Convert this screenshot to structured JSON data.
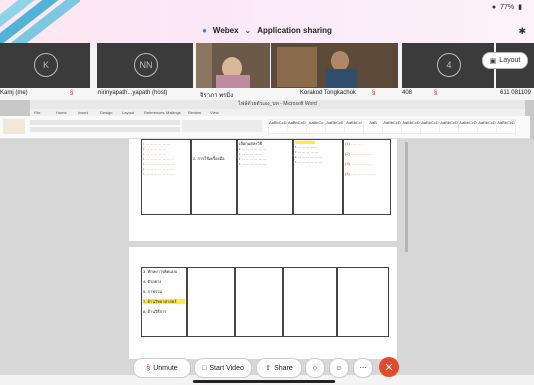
{
  "status": {
    "time": "",
    "wifi": "wifi-icon",
    "battery_pct": "77%",
    "battery": "battery-icon"
  },
  "window": {
    "app": "Webex",
    "title": "Application sharing"
  },
  "layout_button": "Layout",
  "participants": [
    {
      "initial": "K",
      "name": "Kamj (me)"
    },
    {
      "initial": "NN",
      "name": "nirinyapath...yapath (host)"
    },
    {
      "name": "จิราภา พรมิ่ง"
    },
    {
      "name": "Korakod Tongkachok"
    },
    {
      "initial": "4",
      "name": "408"
    },
    {
      "name": "611 081109"
    }
  ],
  "word": {
    "window_title": "ไฟล์ด้วยตัวเอง_บท - Microsoft Word",
    "tabs": [
      "File",
      "Home",
      "Insert",
      "Design",
      "Layout",
      "References",
      "Mailings",
      "Review",
      "View"
    ],
    "styles": [
      "AaBbCcDc",
      "AaBbCcDc",
      "AaBbCc",
      "AaBbCcE",
      "AaBbCcl",
      "AaB",
      "AaBbCcD",
      "AaBbCcD",
      "AaBbCcD",
      "AaBbCcD",
      "AaBbCcD",
      "AaBbCcD",
      "AaBbCcD"
    ]
  },
  "doc": {
    "p1_col2": "2. การใช้เครื่องมือ",
    "p1_col3_title": "เลือกแต่ละวิธี",
    "p2_items": [
      "3. ทักษะการคิดแบบ",
      "4. ตัวอย่าง",
      "5. ภาพรวม",
      "7. ด้านวิทยาศาสตร์",
      "8. ด้านวิธีการ"
    ]
  },
  "controls": {
    "unmute": "Unmute",
    "start_video": "Start Video",
    "share": "Share"
  }
}
